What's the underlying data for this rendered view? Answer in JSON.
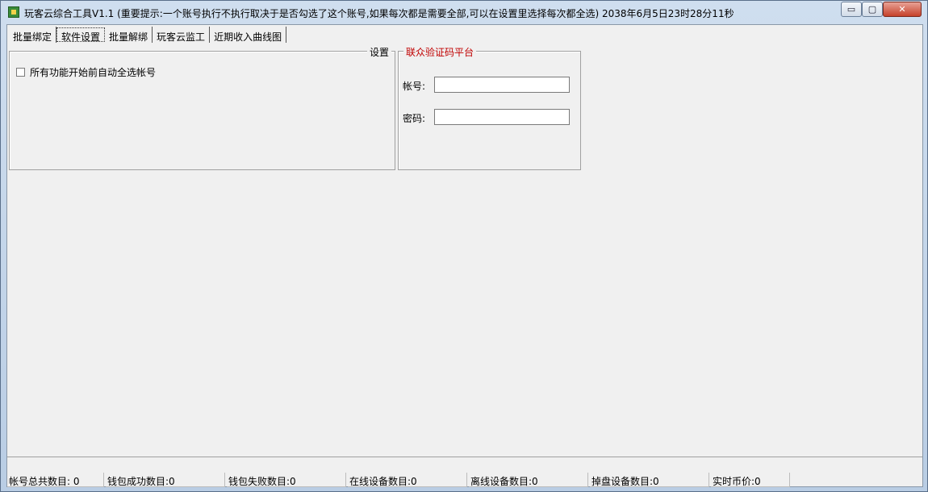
{
  "window": {
    "title": "玩客云综合工具V1.1 (重要提示:一个账号执行不执行取决于是否勾选了这个账号,如果每次都是需要全部,可以在设置里选择每次都全选)  2038年6月5日23时28分11秒",
    "controls": {
      "minimize": "▭",
      "maximize": "▢",
      "close": "✕"
    }
  },
  "tabs": [
    {
      "label": "批量绑定"
    },
    {
      "label": "软件设置",
      "active": true
    },
    {
      "label": "批量解绑"
    },
    {
      "label": "玩客云监工"
    },
    {
      "label": "近期收入曲线图"
    }
  ],
  "settings": {
    "title": "设置",
    "auto_select_label": "所有功能开始前自动全选帐号"
  },
  "captcha": {
    "title": "联众验证码平台",
    "account_label": "帐号:",
    "account_value": "",
    "password_label": "密码:",
    "password_value": ""
  },
  "status": [
    {
      "label": "帐号总共数目: 0"
    },
    {
      "label": "钱包成功数目:0"
    },
    {
      "label": "钱包失败数目:0"
    },
    {
      "label": "在线设备数目:0"
    },
    {
      "label": "离线设备数目:0"
    },
    {
      "label": "掉盘设备数目:0"
    },
    {
      "label": "实时币价:0"
    }
  ]
}
